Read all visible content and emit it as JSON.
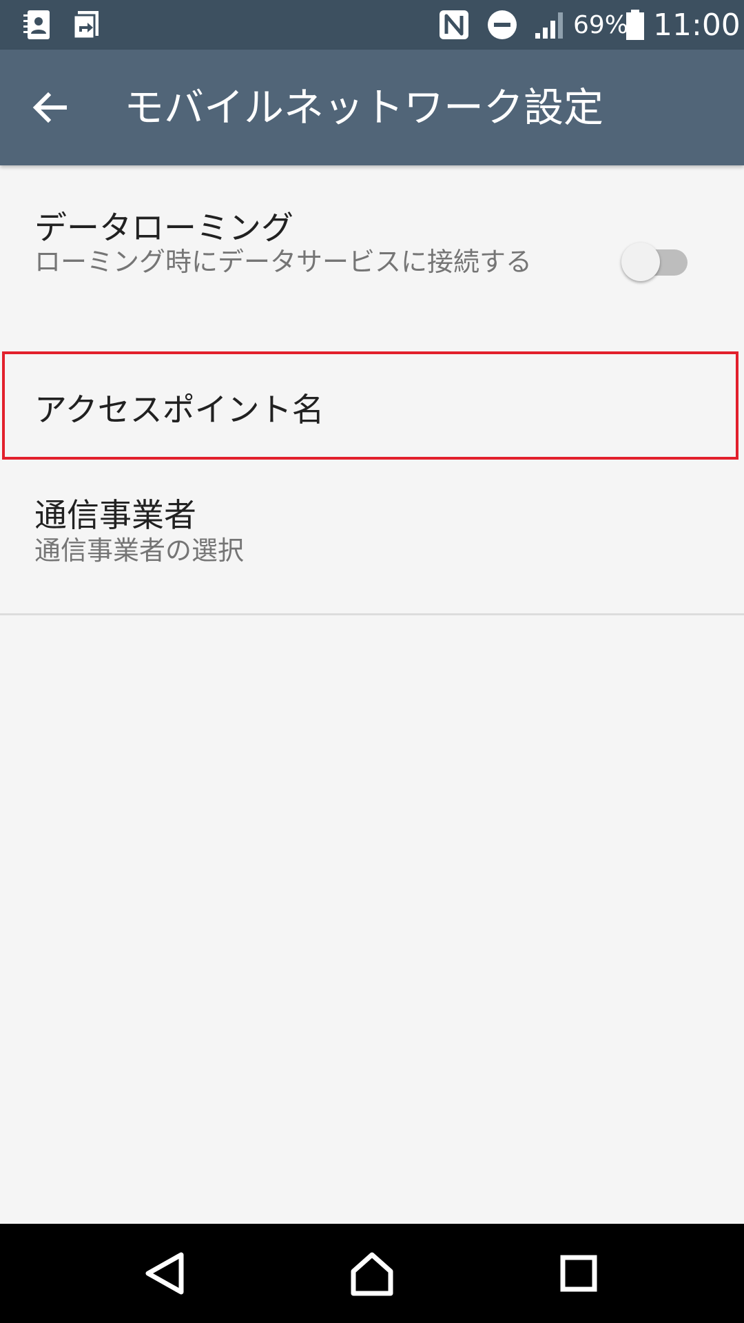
{
  "status_bar": {
    "notification_icons": [
      "contacts-icon",
      "transfer-icon"
    ],
    "system_icons": [
      "nfc-icon",
      "do-not-disturb-icon",
      "cell-signal-icon",
      "battery-icon"
    ],
    "battery_percent": "69%",
    "time": "11:00"
  },
  "app_bar": {
    "back_icon": "arrow-back-icon",
    "title": "モバイルネットワーク設定"
  },
  "preferences": {
    "data_roaming": {
      "title": "データローミング",
      "summary": "ローミング時にデータサービスに接続する",
      "toggle_state": "off"
    },
    "access_point_names": {
      "title": "アクセスポイント名"
    },
    "network_operators": {
      "title": "通信事業者",
      "summary": "通信事業者の選択"
    }
  },
  "colors": {
    "status_bar": "#3d5060",
    "app_bar": "#516578",
    "background": "#f5f5f5",
    "highlight": "#e2202c",
    "nav_bar": "#000000"
  },
  "nav_bar": {
    "icons": [
      "back-triangle-icon",
      "home-icon",
      "recents-icon"
    ]
  }
}
